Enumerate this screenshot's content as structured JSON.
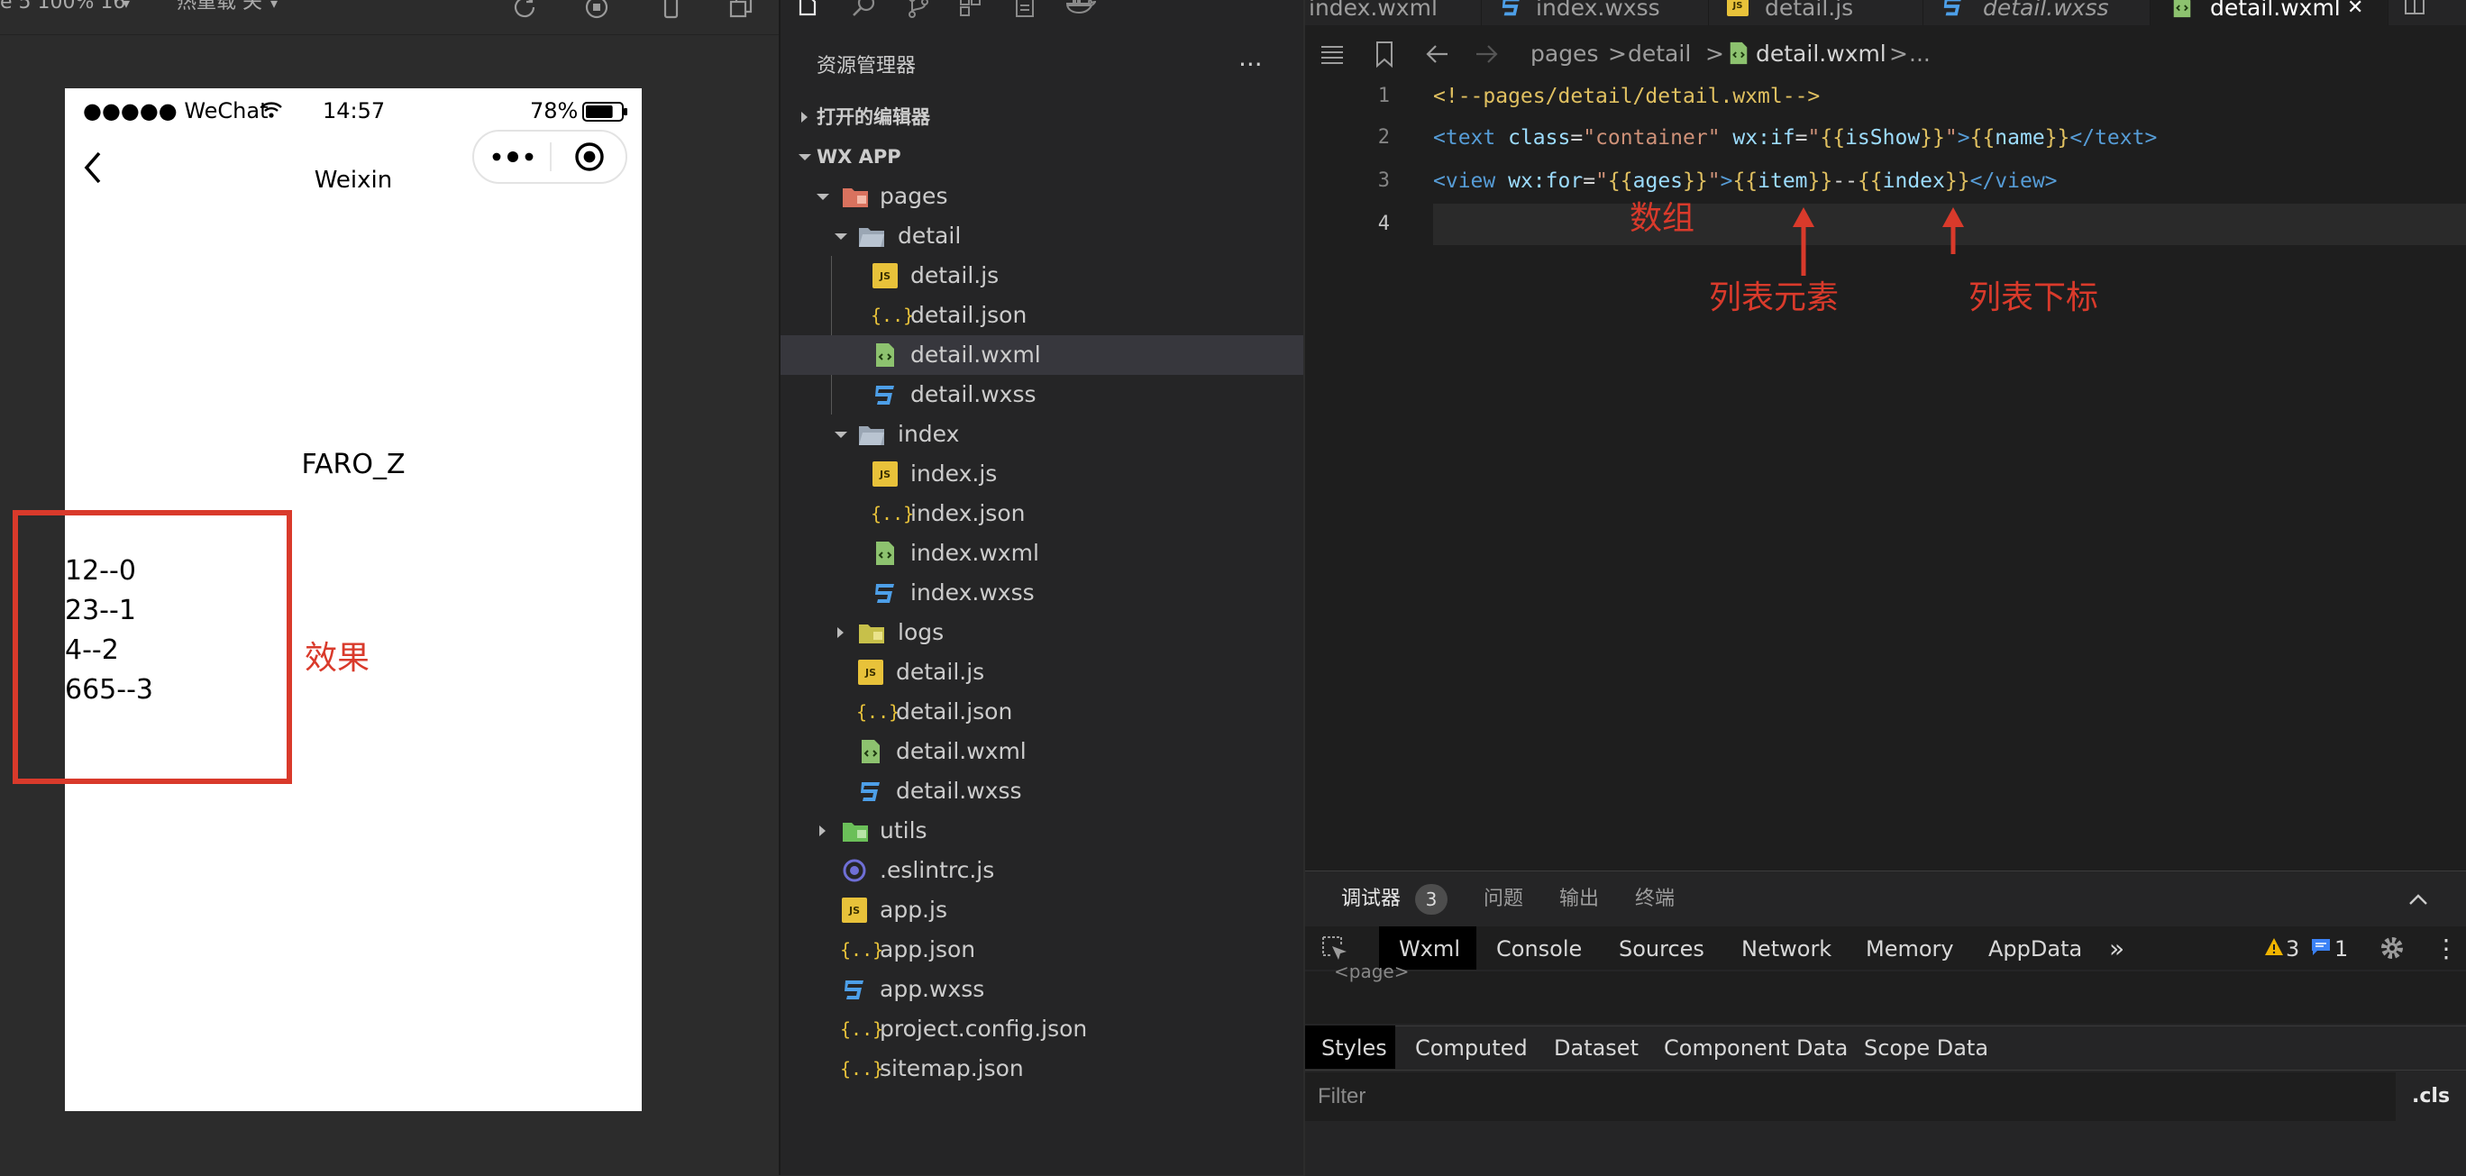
{
  "simulator": {
    "toolbar": {
      "device_label": "e 5 100% 16",
      "hot_reload_label": "热重载 关"
    },
    "status_bar": {
      "carrier": "●●●●● WeChat",
      "time": "14:57",
      "battery": "78%",
      "battery_level": 0.78
    },
    "nav": {
      "title": "Weixin"
    },
    "page": {
      "name": "FARO_Z",
      "list": [
        "12--0",
        "23--1",
        "4--2",
        "665--3"
      ]
    },
    "annotation_effect": "效果"
  },
  "explorer": {
    "title": "资源管理器",
    "more": "···",
    "open_editors": "打开的编辑器",
    "workspace": "WX APP",
    "tree": {
      "pages": "pages",
      "detail": "detail",
      "detail_js": "detail.js",
      "detail_json": "detail.json",
      "detail_wxml": "detail.wxml",
      "detail_wxss": "detail.wxss",
      "index": "index",
      "index_js": "index.js",
      "index_json": "index.json",
      "index_wxml": "index.wxml",
      "index_wxss": "index.wxss",
      "logs": "logs",
      "root_detail_js": "detail.js",
      "root_detail_json": "detail.json",
      "root_detail_wxml": "detail.wxml",
      "root_detail_wxss": "detail.wxss",
      "utils": "utils",
      "eslintrc": ".eslintrc.js",
      "app_js": "app.js",
      "app_json": "app.json",
      "app_wxss": "app.wxss",
      "project_config": "project.config.json",
      "sitemap": "sitemap.json"
    },
    "icon_labels": {
      "js": "JS",
      "json": "{..}"
    }
  },
  "editor": {
    "tabs": [
      "index.wxml",
      "index.wxss",
      "detail.js",
      "detail.wxss",
      "detail.wxml"
    ],
    "close_glyph": "✕",
    "breadcrumb": {
      "pages": "pages",
      "detail": "detail",
      "file": "detail.wxml",
      "ellipsis": "...",
      "sep": ">"
    },
    "line_numbers": [
      "1",
      "2",
      "3",
      "4"
    ],
    "code": {
      "l1": "<!--pages/detail/detail.wxml-->",
      "l2_open": "<text",
      "l2_class_attr": "class",
      "l2_class_val": "\"container\"",
      "l2_if_attr": "wx:if",
      "l2_if_val_q1": "\"",
      "l2_if_b1": "{{",
      "l2_if_var": "isShow",
      "l2_if_b2": "}}",
      "l2_if_val_q2": "\"",
      "l2_close": ">",
      "l2_b1": "{{",
      "l2_var": "name",
      "l2_b2": "}}",
      "l2_end": "</text>",
      "l3_open": "<view",
      "l3_for_attr": "wx:for",
      "l3_q1": "\"",
      "l3_b1": "{{",
      "l3_var": "ages",
      "l3_b2": "}}",
      "l3_q2": "\"",
      "l3_close": ">",
      "l3_b3": "{{",
      "l3_item": "item",
      "l3_b4": "}}",
      "l3_sep": "--",
      "l3_b5": "{{",
      "l3_index": "index",
      "l3_b6": "}}",
      "l3_end": "</view>",
      "eq": "="
    },
    "annotations": {
      "array": "数组",
      "list_item": "列表元素",
      "list_index": "列表下标"
    }
  },
  "panel": {
    "tabs": [
      "调试器",
      "问题",
      "输出",
      "终端"
    ],
    "debugger_badge": "3",
    "devtools_tabs": [
      "Wxml",
      "Console",
      "Sources",
      "Network",
      "Memory",
      "AppData"
    ],
    "more_tabs": "»",
    "warnings": "3",
    "messages": "1",
    "dom_preview": "<page>",
    "style_tabs": [
      "Styles",
      "Computed",
      "Dataset",
      "Component Data",
      "Scope Data"
    ],
    "filter_placeholder": "Filter",
    "cls": ".cls",
    "kebab": "⋮"
  }
}
